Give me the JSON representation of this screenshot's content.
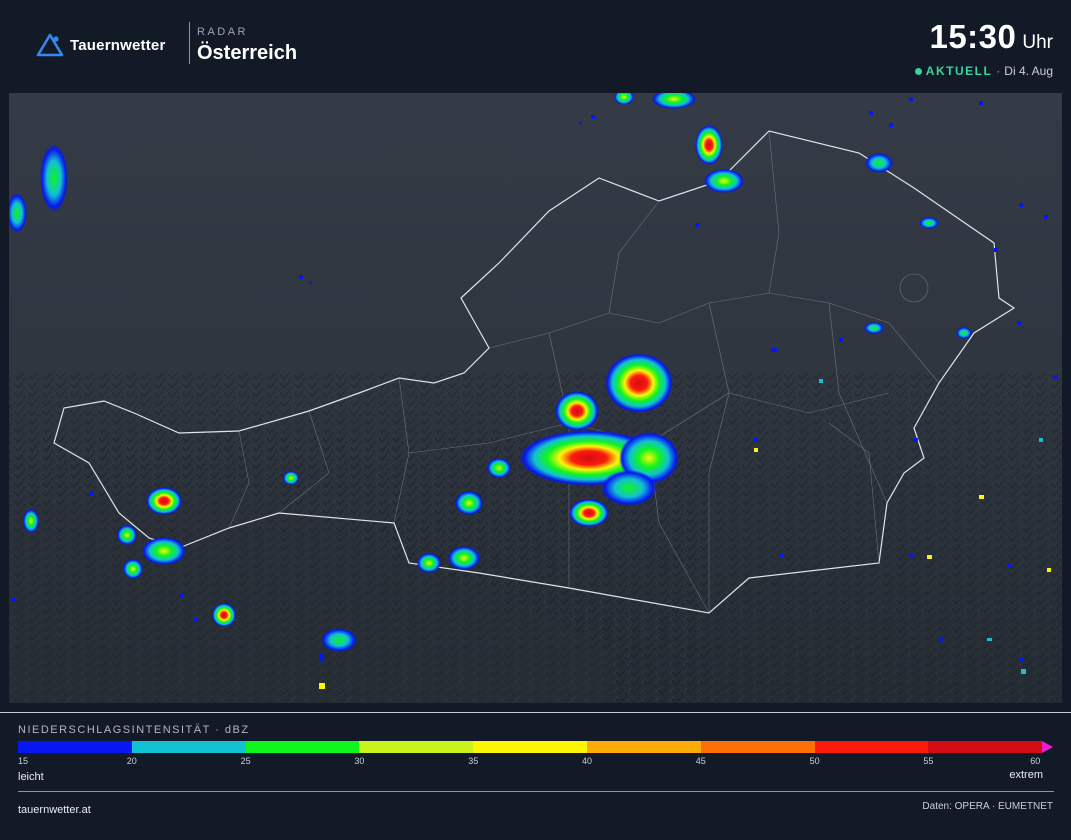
{
  "brand": {
    "name": "Tauernwetter",
    "icon": "mountain-triangle-icon"
  },
  "header": {
    "section_label": "RADAR",
    "region": "Österreich"
  },
  "time": {
    "value": "15:30",
    "unit": "Uhr"
  },
  "status": {
    "label": "AKTUELL",
    "separator": "·",
    "date": "Di 4. Aug",
    "color": "#3cd49a"
  },
  "map": {
    "description_icon": "radar-map",
    "background": "#2b323c"
  },
  "legend": {
    "title": "NIEDERSCHLAGSINTENSITÄT · dBZ",
    "ticks": [
      "15",
      "20",
      "25",
      "30",
      "35",
      "40",
      "45",
      "50",
      "55",
      "60"
    ],
    "colors": [
      "#0717f2",
      "#12c1d2",
      "#0ff51d",
      "#c9f31b",
      "#fcf508",
      "#ffab0a",
      "#fd6f07",
      "#fb1a0c",
      "#d50c15"
    ],
    "arrow_color": "#e81ed1",
    "low_label": "leicht",
    "high_label": "extrem"
  },
  "footer": {
    "site": "tauernwetter.at",
    "credits": "Daten: OPERA · EUMETNET"
  }
}
